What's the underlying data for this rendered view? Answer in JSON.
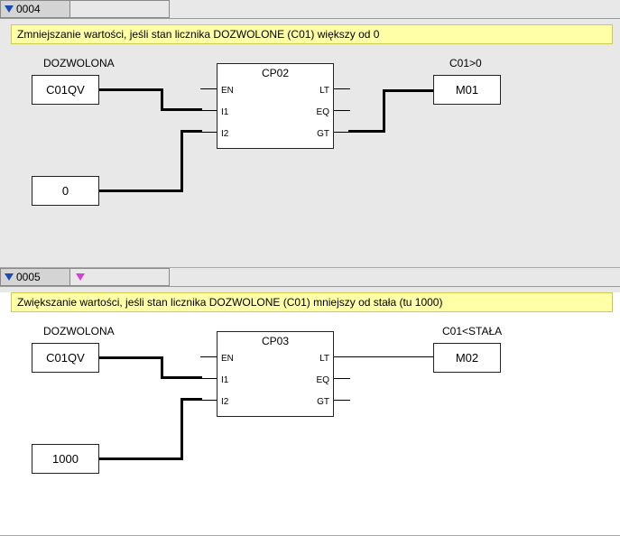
{
  "rungs": [
    {
      "number": "0004",
      "comment": "Zmniejszanie wartości, jeśli stan licznika DOZWOLONE (C01) większy od 0",
      "label1": "DOZWOLONA",
      "label2": "C01>0",
      "inputA": "C01QV",
      "inputB": "0",
      "block": "CP02",
      "pinEN": "EN",
      "pinI1": "I1",
      "pinI2": "I2",
      "pinLT": "LT",
      "pinEQ": "EQ",
      "pinGT": "GT",
      "output": "M01"
    },
    {
      "number": "0005",
      "comment": "Zwiększanie wartości, jeśli stan licznika DOZWOLONE (C01) mniejszy od stała (tu 1000)",
      "label1": "DOZWOLONA",
      "label2": "C01<STAŁA",
      "inputA": "C01QV",
      "inputB": "1000",
      "block": "CP03",
      "pinEN": "EN",
      "pinI1": "I1",
      "pinI2": "I2",
      "pinLT": "LT",
      "pinEQ": "EQ",
      "pinGT": "GT",
      "output": "M02"
    }
  ]
}
